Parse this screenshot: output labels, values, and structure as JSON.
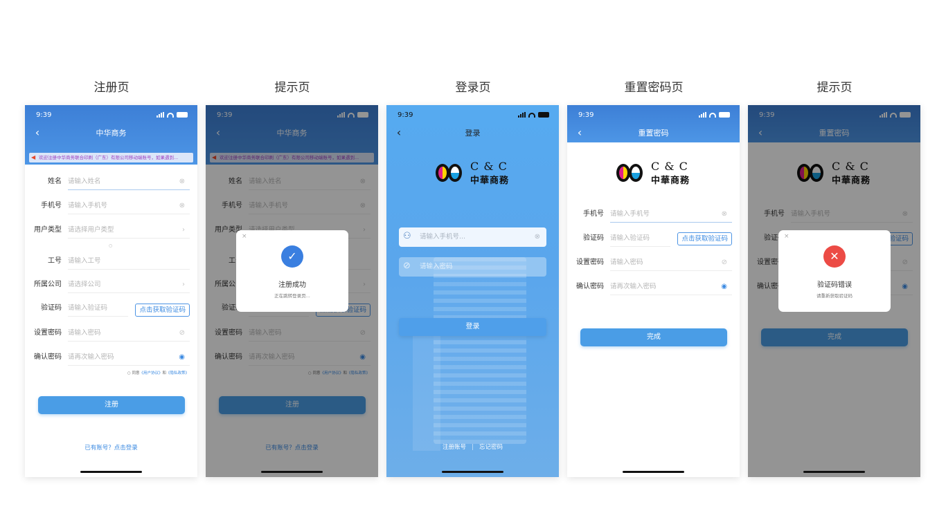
{
  "columns": [
    {
      "title": "注册页"
    },
    {
      "title": "提示页"
    },
    {
      "title": "登录页"
    },
    {
      "title": "重置密码页"
    },
    {
      "title": "提示页"
    }
  ],
  "status_time": "9:39",
  "register": {
    "nav_title": "中华商务",
    "notice": "欢迎注册中华商务联合印刷（广东）有限公司移动端账号，如果遇到...",
    "fields": [
      {
        "label": "姓名",
        "placeholder": "请输入姓名"
      },
      {
        "label": "手机号",
        "placeholder": "请输入手机号"
      },
      {
        "label": "用户类型",
        "placeholder": "请选择用户类型"
      },
      {
        "label": "工号",
        "placeholder": "请输入工号"
      },
      {
        "label": "所属公司",
        "placeholder": "请选择公司"
      },
      {
        "label": "验证码",
        "placeholder": "请输入验证码"
      },
      {
        "label": "设置密码",
        "placeholder": "请输入密码"
      },
      {
        "label": "确认密码",
        "placeholder": "请再次输入密码"
      }
    ],
    "get_code": "点击获取验证码",
    "agree_prefix": "同意",
    "user_agreement": "《用户协议》",
    "agree_and": "和",
    "privacy_policy": "《隐私政策》",
    "submit": "注册",
    "login_link": "已有账号？点击登录"
  },
  "register_success_modal": {
    "title": "注册成功",
    "subtitle": "正在跳转登录页..."
  },
  "login": {
    "nav_title": "登录",
    "logo_en": "C & C",
    "logo_cn": "中華商務",
    "phone_placeholder": "请输入手机号...",
    "password_placeholder": "请输入密码",
    "submit": "登录",
    "register_link": "注册账号",
    "separator": "|",
    "forgot_link": "忘记密码"
  },
  "reset": {
    "nav_title": "重置密码",
    "fields": [
      {
        "label": "手机号",
        "placeholder": "请输入手机号"
      },
      {
        "label": "验证码",
        "placeholder": "请输入验证码"
      },
      {
        "label": "设置密码",
        "placeholder": "请输入密码"
      },
      {
        "label": "确认密码",
        "placeholder": "请再次输入密码"
      }
    ],
    "get_code": "点击获取验证码",
    "submit": "完成"
  },
  "code_error_modal": {
    "title": "验证码错误",
    "subtitle": "请重新获取验证码"
  },
  "colors": {
    "primary": "#4a9de6",
    "success_badge": "#3a7fe0",
    "error_badge": "#ec4b45"
  }
}
